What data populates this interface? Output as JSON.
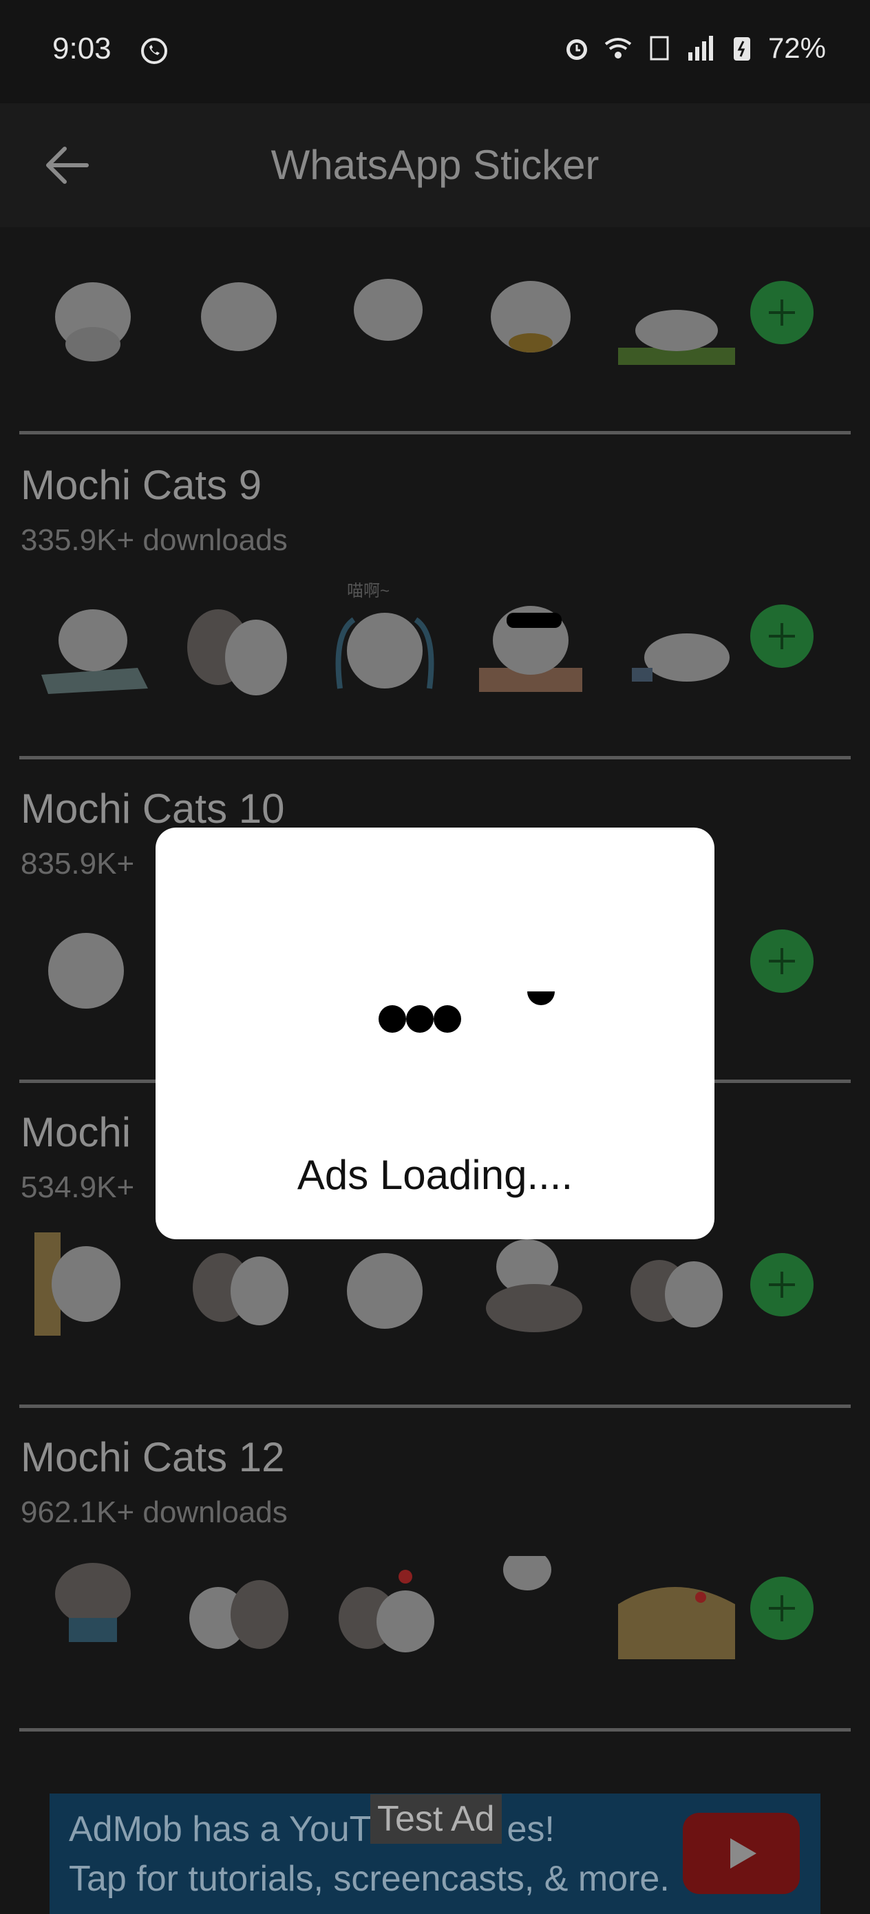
{
  "status_bar": {
    "time": "9:03",
    "battery": "72%",
    "icons": [
      "whatsapp-icon",
      "alarm-icon",
      "wifi-icon",
      "volte-icon",
      "signal-icon",
      "battery-icon"
    ]
  },
  "app_bar": {
    "title": "WhatsApp Sticker"
  },
  "packs": [
    {
      "title": "",
      "downloads": ""
    },
    {
      "title": "Mochi Cats 9",
      "downloads": "335.9K+ downloads"
    },
    {
      "title": "Mochi Cats 10",
      "downloads": "835.9K+"
    },
    {
      "title": "Mochi",
      "downloads": "534.9K+"
    },
    {
      "title": "Mochi Cats 12",
      "downloads": "962.1K+ downloads"
    }
  ],
  "sticker_caption": "喵啊~",
  "dialog": {
    "text": "Ads Loading...."
  },
  "ad": {
    "tag": "Test Ad",
    "line1": "AdMob has a YouTu",
    "line1_end": "es!",
    "line2": "Tap for tutorials, screencasts, & more."
  },
  "colors": {
    "add_button": "#1f6b30",
    "background": "#161616",
    "ad_background": "#0f3550"
  }
}
